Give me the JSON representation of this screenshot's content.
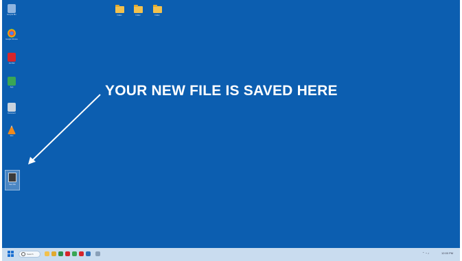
{
  "annotation": {
    "text": "YOUR NEW FILE IS SAVED HERE"
  },
  "desktop": {
    "left_icons": [
      {
        "name": "recycle-bin-icon",
        "color": "#8fb5e0",
        "label": "Recycle Bin"
      },
      {
        "name": "chrome-icon",
        "color": "#f5c542",
        "label": "Google Chrome"
      },
      {
        "name": "acrobat-icon",
        "color": "#d6252b",
        "label": "Acrobat"
      },
      {
        "name": "app-green-icon",
        "color": "#3aa655",
        "label": "App"
      },
      {
        "name": "app-document-icon",
        "color": "#c9d3de",
        "label": "Document"
      },
      {
        "name": "vlc-icon",
        "color": "#f08a1c",
        "label": "VLC"
      }
    ],
    "folders": [
      {
        "label": "Folder"
      },
      {
        "label": "Folder"
      },
      {
        "label": "Folder"
      }
    ],
    "saved_file": {
      "label": "New File"
    }
  },
  "taskbar": {
    "search_placeholder": "Search",
    "apps": [
      {
        "name": "taskbar-files-icon",
        "color": "#f2c14e"
      },
      {
        "name": "taskbar-app-icon",
        "color": "#e0a92e"
      },
      {
        "name": "taskbar-app-icon",
        "color": "#2f8f4e"
      },
      {
        "name": "taskbar-app-icon",
        "color": "#d6252b"
      },
      {
        "name": "taskbar-app-icon",
        "color": "#3aa655"
      },
      {
        "name": "taskbar-app-icon",
        "color": "#d6252b"
      },
      {
        "name": "taskbar-app-icon",
        "color": "#2a6fb8"
      },
      {
        "name": "taskbar-app-icon",
        "color": "#8aa0b8"
      }
    ],
    "clock": "12:00 PM"
  }
}
